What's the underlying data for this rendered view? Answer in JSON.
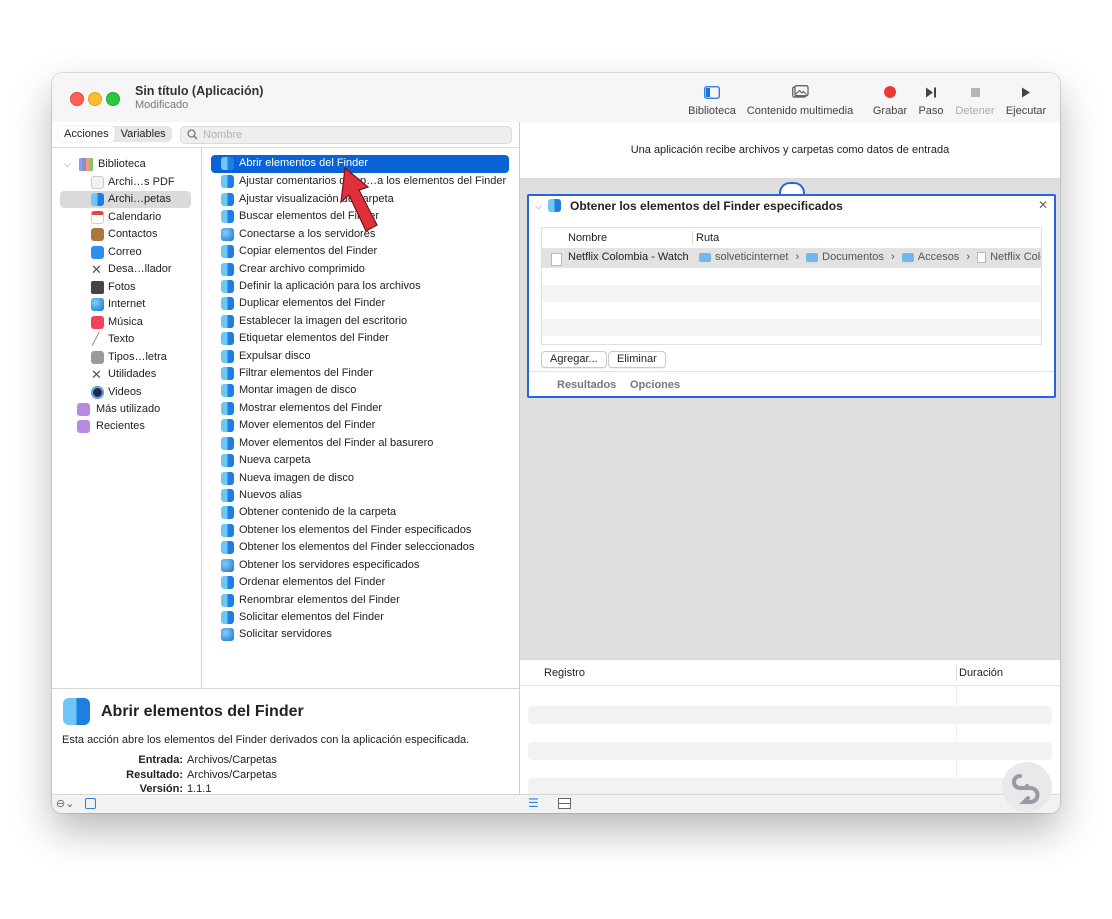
{
  "window": {
    "title": "Sin título (Aplicación)",
    "subtitle": "Modificado"
  },
  "toolbar": {
    "library": "Biblioteca",
    "media": "Contenido multimedia",
    "record": "Grabar",
    "step": "Paso",
    "stop": "Detener",
    "run": "Ejecutar"
  },
  "tabs": {
    "actions": "Acciones",
    "variables": "Variables"
  },
  "search": {
    "placeholder": "Nombre"
  },
  "library": {
    "root": "Biblioteca",
    "items": [
      "Archi…s PDF",
      "Archi…petas",
      "Calendario",
      "Contactos",
      "Correo",
      "Desa…llador",
      "Fotos",
      "Internet",
      "Música",
      "Texto",
      "Tipos…letra",
      "Utilidades",
      "Videos"
    ],
    "extra": [
      "Más utilizado",
      "Recientes"
    ]
  },
  "actions": [
    "Abrir elementos del Finder",
    "Ajustar comentarios de sp…a los elementos del Finder",
    "Ajustar visualización de carpeta",
    "Buscar elementos del Finder",
    "Conectarse a los servidores",
    "Copiar elementos del Finder",
    "Crear archivo comprimido",
    "Definir la aplicación para los archivos",
    "Duplicar elementos del Finder",
    "Establecer la imagen del escritorio",
    "Etiquetar elementos del Finder",
    "Expulsar disco",
    "Filtrar elementos del Finder",
    "Montar imagen de disco",
    "Mostrar elementos del Finder",
    "Mover elementos del Finder",
    "Mover elementos del Finder al basurero",
    "Nueva carpeta",
    "Nueva imagen de disco",
    "Nuevos alias",
    "Obtener contenido de la carpeta",
    "Obtener los elementos del Finder especificados",
    "Obtener los elementos del Finder seleccionados",
    "Obtener los servidores especificados",
    "Ordenar elementos del Finder",
    "Renombrar elementos del Finder",
    "Solicitar elementos del Finder",
    "Solicitar servidores"
  ],
  "info": {
    "title": "Abrir elementos del Finder",
    "description": "Esta acción abre los elementos del Finder derivados con la aplicación especificada.",
    "input_label": "Entrada:",
    "input_value": "Archivos/Carpetas",
    "result_label": "Resultado:",
    "result_value": "Archivos/Carpetas",
    "version_label": "Versión:",
    "version_value": "1.1.1"
  },
  "workflow": {
    "header": "Una aplicación recibe archivos y carpetas como datos de entrada",
    "card_title": "Obtener los elementos del Finder especificados",
    "col_name": "Nombre",
    "col_path": "Ruta",
    "row_name": "Netflix Colombia - Watch",
    "path": [
      "solveticinternet",
      "Documentos",
      "Accesos",
      "Netflix Colo"
    ],
    "sep": "›",
    "add": "Agregar...",
    "remove": "Eliminar",
    "results": "Resultados",
    "options": "Opciones"
  },
  "log": {
    "col_log": "Registro",
    "col_duration": "Duración"
  }
}
